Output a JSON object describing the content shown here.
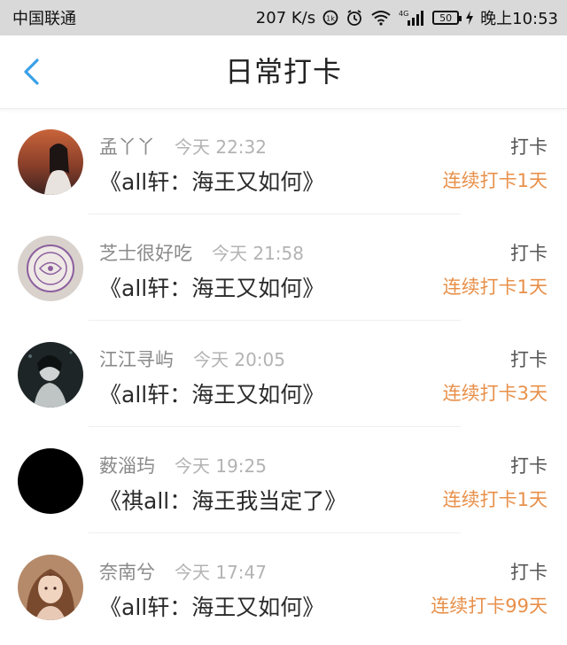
{
  "status_bar": {
    "carrier": "中国联通",
    "speed": "207 K/s",
    "network": "4G",
    "battery": "50",
    "time": "晚上10:53"
  },
  "header": {
    "title": "日常打卡",
    "back_icon": "chevron-left-icon",
    "accent_color": "#3aa0e8"
  },
  "colors": {
    "streak": "#e8904a",
    "muted": "#8a8a8a"
  },
  "feed": [
    {
      "name": "孟丫丫",
      "time": "今天 22:32",
      "book": "《all轩：海王又如何》",
      "action": "打卡",
      "streak": "连续打卡1天"
    },
    {
      "name": "芝士很好吃",
      "time": "今天 21:58",
      "book": "《all轩：海王又如何》",
      "action": "打卡",
      "streak": "连续打卡1天"
    },
    {
      "name": "江江寻屿",
      "time": "今天 20:05",
      "book": "《all轩：海王又如何》",
      "action": "打卡",
      "streak": "连续打卡3天"
    },
    {
      "name": "薮淄玙",
      "time": "今天 19:25",
      "book": "《祺all：海王我当定了》",
      "action": "打卡",
      "streak": "连续打卡1天"
    },
    {
      "name": "奈南兮",
      "time": "今天 17:47",
      "book": "《all轩：海王又如何》",
      "action": "打卡",
      "streak": "连续打卡99天"
    }
  ]
}
